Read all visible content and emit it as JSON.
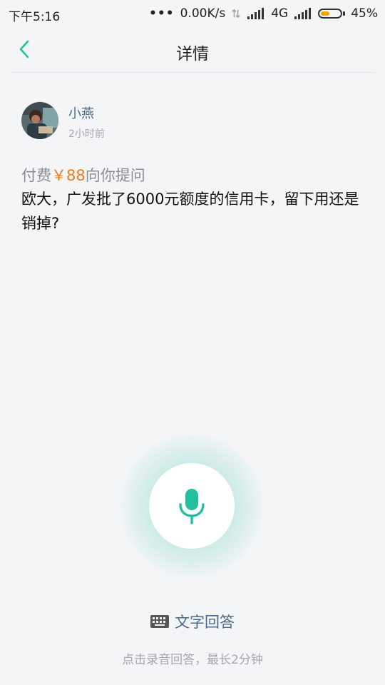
{
  "status_bar": {
    "time": "下午5:16",
    "network_speed": "0.00K/s",
    "network_type": "4G",
    "battery_percent": "45%",
    "battery_level": 0.45
  },
  "header": {
    "title": "详情",
    "back_icon": "chevron-left-icon"
  },
  "question": {
    "user_name": "小燕",
    "time_ago": "2小时前",
    "paid_prefix": "付费",
    "price": "￥88",
    "paid_suffix": "向你提问",
    "text": "欧大，广发批了6000元额度的信用卡，留下用还是销掉?"
  },
  "answer": {
    "mic_icon": "microphone-icon",
    "text_answer_label": "文字回答",
    "hint": "点击录音回答，最长2分钟"
  },
  "colors": {
    "accent": "#26bf9e",
    "price": "#f07c1c",
    "link": "#4a6a8c",
    "background": "#f4f5f7"
  }
}
